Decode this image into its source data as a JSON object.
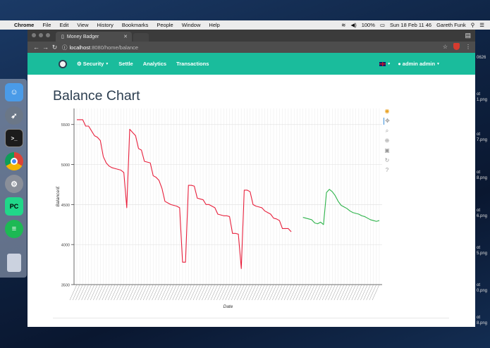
{
  "menubar": {
    "app": "Chrome",
    "items": [
      "File",
      "Edit",
      "View",
      "History",
      "Bookmarks",
      "People",
      "Window",
      "Help"
    ],
    "battery": "100%",
    "datetime": "Sun 18 Feb 11 46",
    "user": "Gareth Funk"
  },
  "browser": {
    "tab_title": "Money Badger",
    "url_host": "localhost",
    "url_path": ":8080/home/balance"
  },
  "nav": {
    "security": "Security",
    "settle": "Settle",
    "analytics": "Analytics",
    "transactions": "Transactions",
    "user": "admin admin"
  },
  "page": {
    "title": "Balance Chart"
  },
  "right_strip": [
    "0626",
    "ot",
    "1.png",
    "ot",
    "7.png",
    "ot",
    "8.png",
    "ot",
    "6.png",
    "ot",
    "5.png",
    "ot",
    "0.png",
    "ot",
    "8.png"
  ],
  "colors": {
    "primary": "#1abc9c",
    "series1": "#e8203c",
    "series2": "#2db34a"
  },
  "chart_data": {
    "type": "line",
    "xlabel": "Date",
    "ylabel": "Balance/£",
    "ylim": [
      3500,
      5700
    ],
    "yticks": [
      3500,
      4000,
      4500,
      5000,
      5500
    ],
    "series": [
      {
        "color": "#e8203c",
        "values": [
          5560,
          5560,
          5560,
          5480,
          5480,
          5420,
          5360,
          5340,
          5300,
          5100,
          5020,
          4980,
          4960,
          4950,
          4940,
          4930,
          4900,
          4460,
          5440,
          5400,
          5360,
          5200,
          5180,
          5040,
          5030,
          5020,
          4860,
          4840,
          4800,
          4700,
          4540,
          4520,
          4500,
          4490,
          4480,
          4460,
          3780,
          3780,
          4740,
          4740,
          4730,
          4580,
          4570,
          4560,
          4500,
          4500,
          4480,
          4460,
          4380,
          4370,
          4360,
          4360,
          4350,
          4140,
          4140,
          4130,
          3700,
          4680,
          4680,
          4660,
          4500,
          4480,
          4470,
          4460,
          4420,
          4400,
          4380,
          4330,
          4320,
          4300,
          4200,
          4200,
          4200,
          4160
        ],
        "x_start": 0
      },
      {
        "color": "#2db34a",
        "values": [
          4340,
          4330,
          4320,
          4310,
          4270,
          4260,
          4280,
          4250,
          4650,
          4690,
          4660,
          4610,
          4540,
          4490,
          4470,
          4450,
          4420,
          4400,
          4390,
          4380,
          4360,
          4350,
          4330,
          4310,
          4300,
          4290,
          4300
        ],
        "x_start": 77
      }
    ]
  }
}
